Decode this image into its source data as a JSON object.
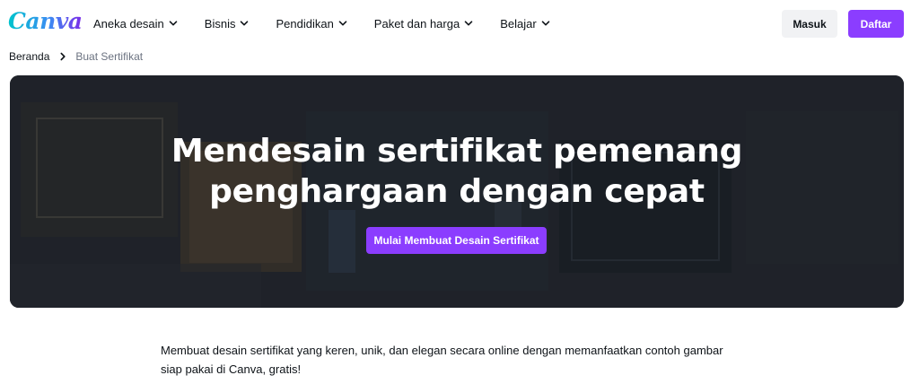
{
  "header": {
    "logo": "Canva",
    "nav": [
      {
        "label": "Aneka desain"
      },
      {
        "label": "Bisnis"
      },
      {
        "label": "Pendidikan"
      },
      {
        "label": "Paket dan harga"
      },
      {
        "label": "Belajar"
      }
    ],
    "login_label": "Masuk",
    "signup_label": "Daftar"
  },
  "breadcrumb": {
    "home": "Beranda",
    "current": "Buat Sertifikat"
  },
  "hero": {
    "title_line1": "Mendesain sertifikat pemenang",
    "title_line2": "penghargaan dengan cepat",
    "cta_label": "Mulai Membuat Desain Sertifikat"
  },
  "description": "Membuat desain sertifikat yang keren, unik, dan elegan secara online dengan memanfaatkan contoh gambar siap pakai di Canva, gratis!",
  "colors": {
    "brand_purple": "#8b3dff",
    "hero_bg": "#20252b",
    "text": "#0e1318",
    "muted": "#6b7280",
    "login_bg": "#f1f2f4"
  },
  "icons": {
    "nav_dropdown": "chevron-down-icon",
    "breadcrumb_separator": "chevron-right-icon"
  }
}
